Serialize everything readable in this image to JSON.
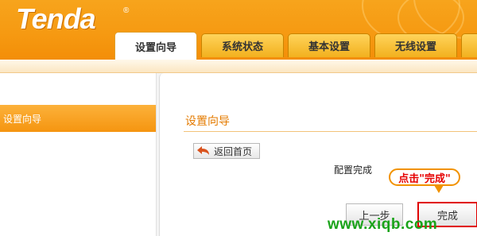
{
  "brand": {
    "logo": "Tenda",
    "registered": "®"
  },
  "tabs": [
    {
      "label": "设置向导",
      "active": true
    },
    {
      "label": "系统状态",
      "active": false
    },
    {
      "label": "基本设置",
      "active": false
    },
    {
      "label": "无线设置",
      "active": false
    },
    {
      "label": "",
      "active": false
    }
  ],
  "sidebar": {
    "items": [
      {
        "label": "设置向导",
        "active": true
      }
    ]
  },
  "main": {
    "title": "设置向导",
    "back_label": "返回首页",
    "status_text": "配置完成",
    "callout": "点击\"完成\"",
    "prev_label": "上一步",
    "finish_label": "完成"
  },
  "watermark": "www.xiqb.com",
  "colors": {
    "header": "#f69a12",
    "accent_text": "#e47b00",
    "highlight": "#e00000",
    "watermark": "#1aa31a"
  },
  "icons": {
    "back": "back-arrow-icon"
  }
}
